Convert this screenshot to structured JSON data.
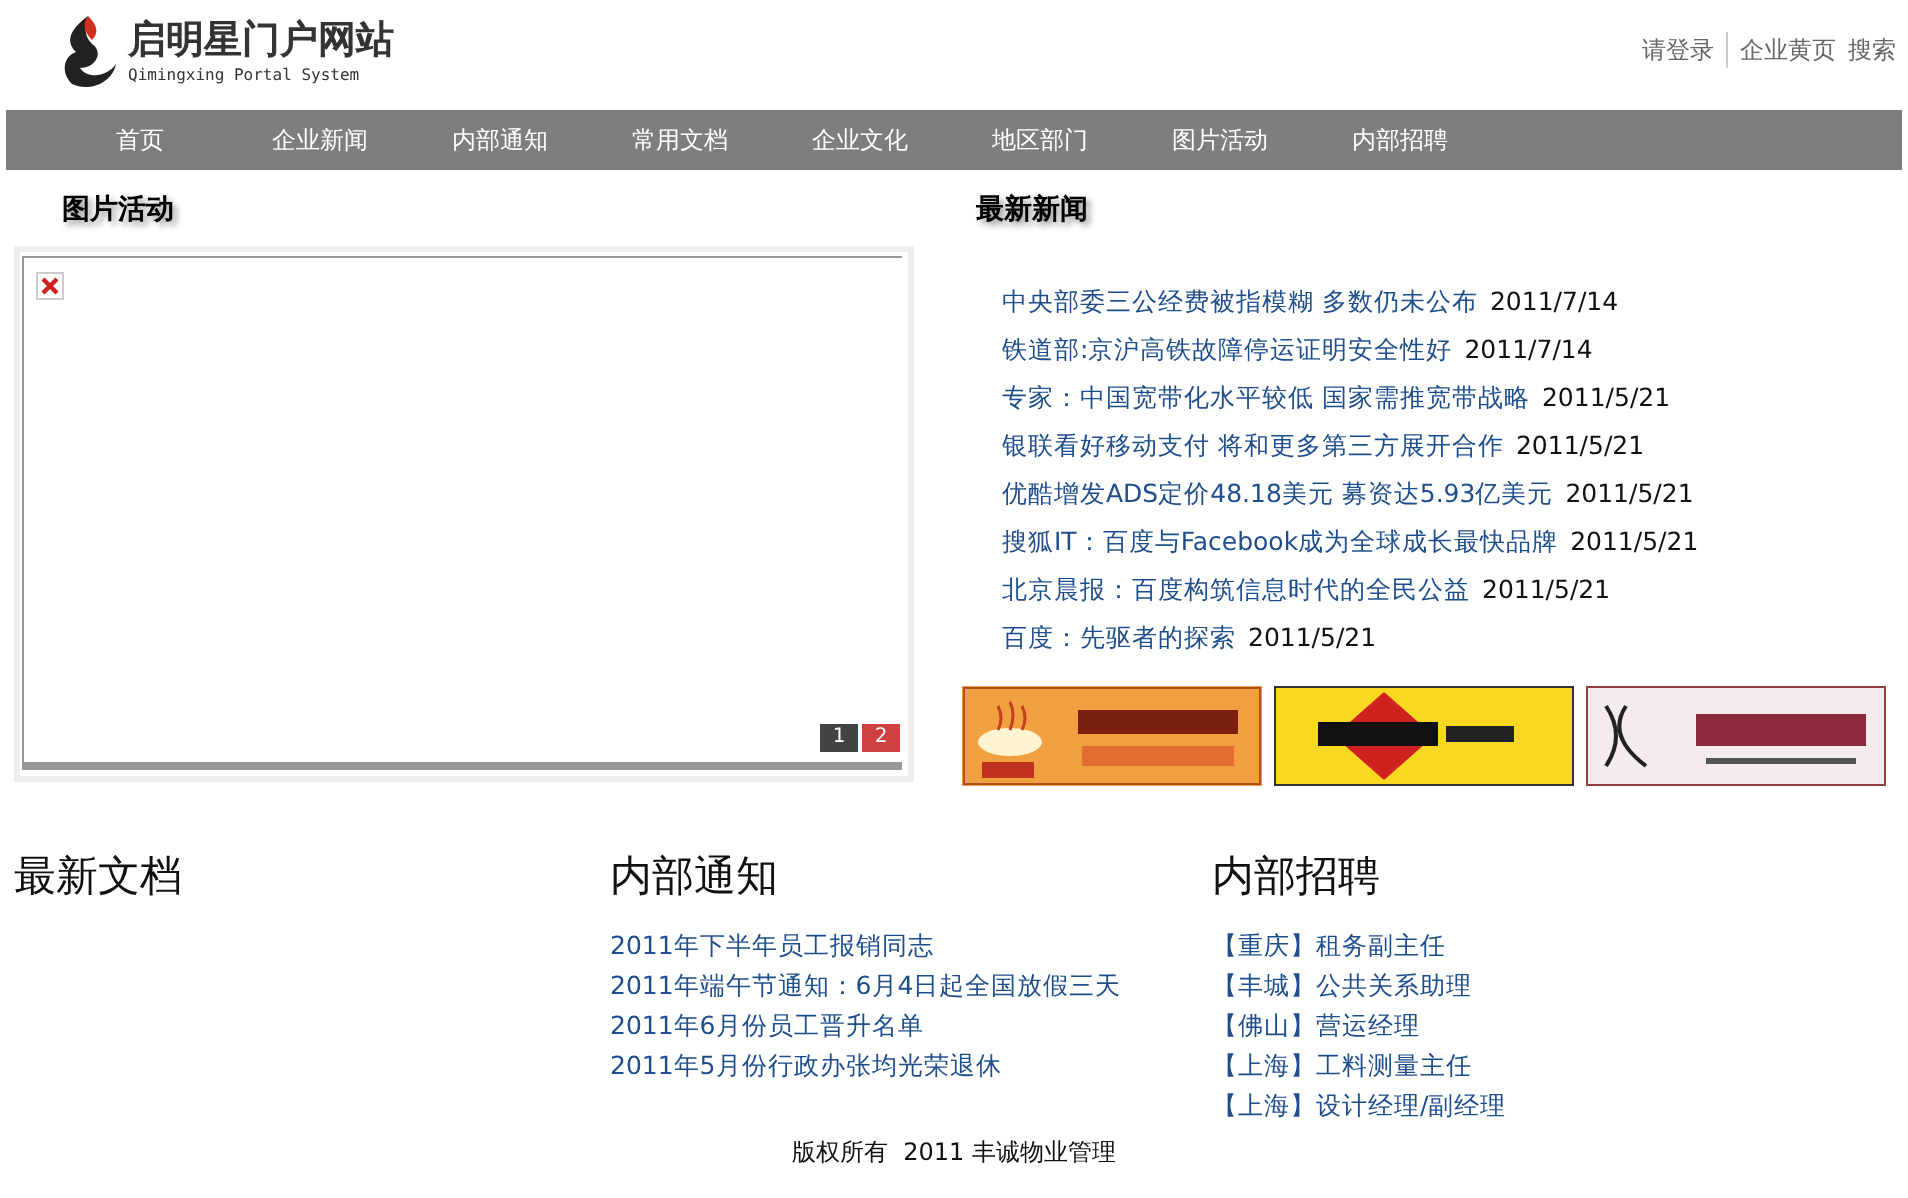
{
  "header": {
    "site_title": "启明星门户网站",
    "site_subtitle": "Qimingxing Portal System",
    "links": [
      "请登录",
      "企业黄页",
      "搜索"
    ]
  },
  "nav": [
    "首页",
    "企业新闻",
    "内部通知",
    "常用文档",
    "企业文化",
    "地区部门",
    "图片活动",
    "内部招聘"
  ],
  "photo_section": {
    "title": "图片活动",
    "pager": [
      {
        "label": "1",
        "selected": false
      },
      {
        "label": "2",
        "selected": true
      }
    ]
  },
  "news_section": {
    "title": "最新新闻",
    "items": [
      {
        "title": "中央部委三公经费被指模糊 多数仍未公布",
        "date": "2011/7/14"
      },
      {
        "title": "铁道部:京沪高铁故障停运证明安全性好",
        "date": "2011/7/14"
      },
      {
        "title": "专家：中国宽带化水平较低 国家需推宽带战略",
        "date": "2011/5/21"
      },
      {
        "title": "银联看好移动支付 将和更多第三方展开合作",
        "date": "2011/5/21"
      },
      {
        "title": "优酷增发ADS定价48.18美元 募资达5.93亿美元",
        "date": "2011/5/21"
      },
      {
        "title": "搜狐IT：百度与Facebook成为全球成长最快品牌",
        "date": "2011/5/21"
      },
      {
        "title": "北京晨报：百度构筑信息时代的全民公益",
        "date": "2011/5/21"
      },
      {
        "title": "百度：先驱者的探索",
        "date": "2011/5/21"
      }
    ]
  },
  "columns": [
    {
      "title": "最新文档"
    },
    {
      "title": "内部通知",
      "items": [
        "2011年下半年员工报销同志",
        "2011年端午节通知：6月4日起全国放假三天",
        "2011年6月份员工晋升名单",
        "2011年5月份行政办张均光荣退休"
      ]
    },
    {
      "title": "内部招聘",
      "items": [
        "【重庆】租务副主任",
        "【丰城】公共关系助理",
        "【佛山】营运经理",
        "【上海】工料测量主任",
        "【上海】设计经理/副经理"
      ]
    }
  ],
  "footer": "版权所有  2011 丰诚物业管理"
}
